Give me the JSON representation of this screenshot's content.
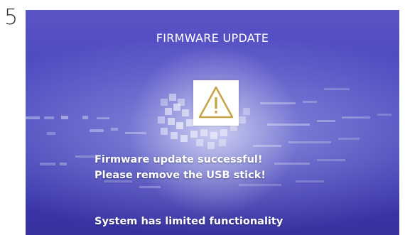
{
  "step": {
    "number": "5"
  },
  "screen": {
    "title": "FIRMWARE UPDATE",
    "warning_icon": "warning-triangle-icon",
    "message_line_1": "Firmware update successful!",
    "message_line_2": "Please remove the USB stick!",
    "status_text": "System has limited functionality"
  },
  "colors": {
    "screen_background": "#4a47bf",
    "warning_accent": "#c9a54a",
    "text": "#ffffff"
  }
}
